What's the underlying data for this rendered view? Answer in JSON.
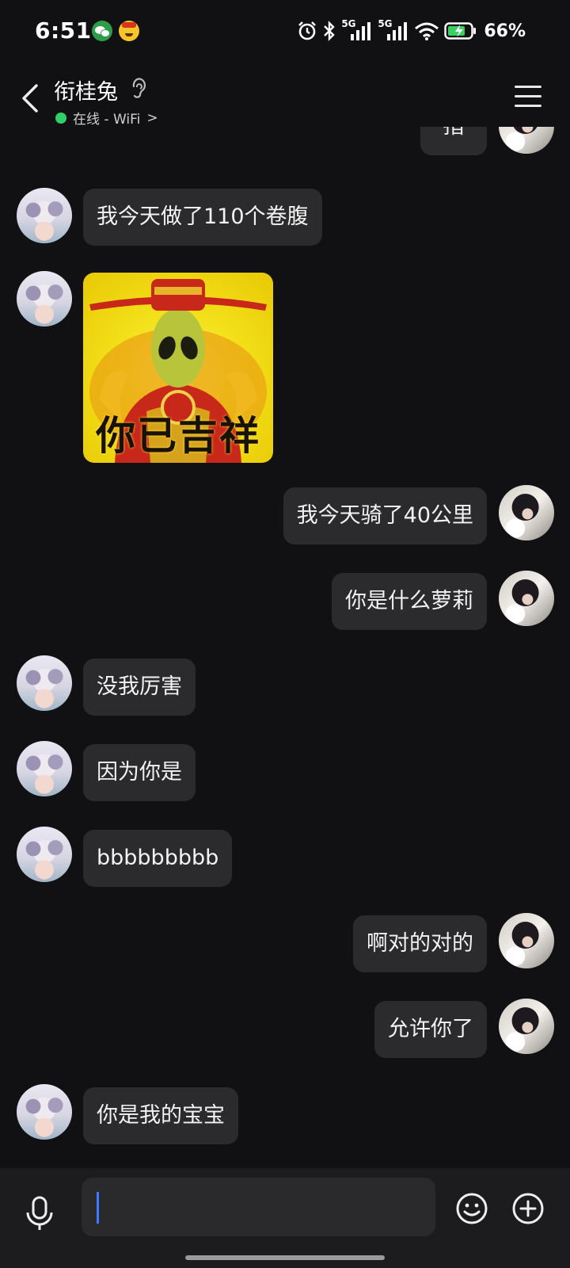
{
  "status_bar": {
    "time": "6:51",
    "battery": "66%",
    "network_labels": [
      "5G",
      "5G"
    ],
    "notification_icons": [
      "wechat-icon",
      "app-face-icon"
    ],
    "system_icons": [
      "alarm-icon",
      "bluetooth-icon",
      "signal-5g-icon",
      "signal-5g-icon",
      "wifi-icon",
      "battery-charging-icon"
    ]
  },
  "header": {
    "contact_name": "衔桂兔",
    "status_text": "在线 - WiFi",
    "status_chevron": ">",
    "icons": [
      "back-icon",
      "ear-icon",
      "menu-icon"
    ],
    "online_color": "#2fd06a"
  },
  "messages": [
    {
      "side": "right",
      "type": "text",
      "text": "指"
    },
    {
      "side": "left",
      "type": "text",
      "text": "我今天做了110个卷腹"
    },
    {
      "side": "left",
      "type": "sticker",
      "caption": "你已吉祥"
    },
    {
      "side": "right",
      "type": "text",
      "text": "我今天骑了40公里"
    },
    {
      "side": "right",
      "type": "text",
      "text": "你是什么萝莉"
    },
    {
      "side": "left",
      "type": "text",
      "text": "没我厉害"
    },
    {
      "side": "left",
      "type": "text",
      "text": "因为你是"
    },
    {
      "side": "left",
      "type": "text",
      "text": "bbbbbbbbb"
    },
    {
      "side": "right",
      "type": "text",
      "text": "啊对的对的"
    },
    {
      "side": "right",
      "type": "text",
      "text": "允许你了"
    },
    {
      "side": "left",
      "type": "text",
      "text": "你是我的宝宝"
    }
  ],
  "input_bar": {
    "value": "",
    "icons": [
      "microphone-icon",
      "emoji-icon",
      "plus-icon"
    ]
  },
  "colors": {
    "background": "#111113",
    "bubble": "#2b2b2d",
    "input_bar": "#1c1c1e",
    "caret": "#3a7bff"
  }
}
